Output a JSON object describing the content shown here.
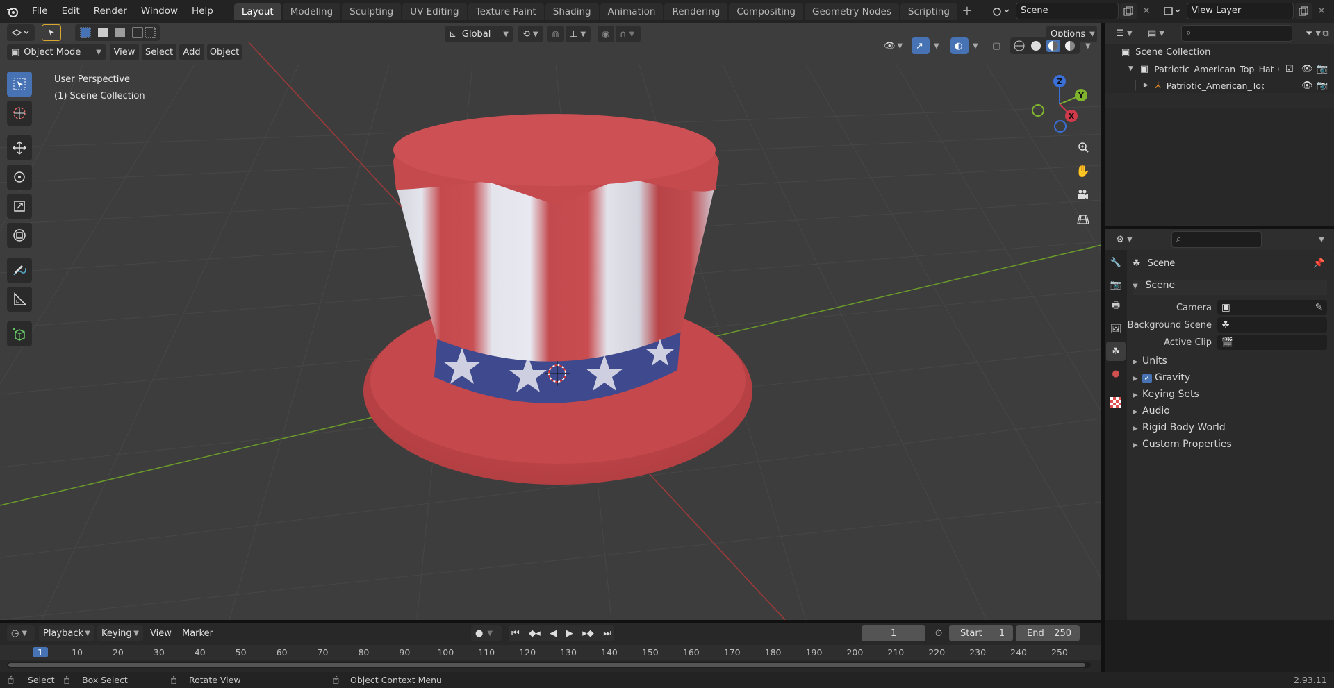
{
  "menu": {
    "items": [
      "File",
      "Edit",
      "Render",
      "Window",
      "Help"
    ]
  },
  "workspaces": {
    "tabs": [
      "Layout",
      "Modeling",
      "Sculpting",
      "UV Editing",
      "Texture Paint",
      "Shading",
      "Animation",
      "Rendering",
      "Compositing",
      "Geometry Nodes",
      "Scripting"
    ],
    "active": "Layout"
  },
  "topright": {
    "scene": "Scene",
    "view_layer": "View Layer"
  },
  "viewport": {
    "mode": "Object Mode",
    "menus": [
      "View",
      "Select",
      "Add",
      "Object"
    ],
    "orientation": "Global",
    "options": "Options",
    "overlay_line1": "User Perspective",
    "overlay_line2": "(1) Scene Collection",
    "gizmo": {
      "z": "Z",
      "y": "Y",
      "x": "X"
    },
    "colors": {
      "x_axis": "#a03a3a",
      "y_axis": "#6a9a2a",
      "hat_red": "#c04a4e",
      "hat_white": "#e2e2ea",
      "hat_blue": "#3f4a8e"
    }
  },
  "outliner": {
    "root": "Scene Collection",
    "collection": "Patriotic_American_Top_Hat_C",
    "object": "Patriotic_American_Top_H"
  },
  "properties": {
    "context": "Scene",
    "panel_title": "Scene",
    "rows": [
      {
        "label": "Camera",
        "value": ""
      },
      {
        "label": "Background Scene",
        "value": ""
      },
      {
        "label": "Active Clip",
        "value": ""
      }
    ],
    "sections": [
      "Units",
      "Gravity",
      "Keying Sets",
      "Audio",
      "Rigid Body World",
      "Custom Properties"
    ],
    "gravity_checked": true
  },
  "timeline": {
    "menus": [
      "Playback",
      "Keying",
      "View",
      "Marker"
    ],
    "current_frame": "1",
    "start_label": "Start",
    "start": "1",
    "end_label": "End",
    "end": "250",
    "ruler": [
      "1",
      "10",
      "20",
      "30",
      "40",
      "50",
      "60",
      "70",
      "80",
      "90",
      "100",
      "110",
      "120",
      "130",
      "140",
      "150",
      "160",
      "170",
      "180",
      "190",
      "200",
      "210",
      "220",
      "230",
      "240",
      "250"
    ]
  },
  "status": {
    "select": "Select",
    "box_select": "Box Select",
    "rotate_view": "Rotate View",
    "context_menu": "Object Context Menu",
    "version": "2.93.11"
  }
}
